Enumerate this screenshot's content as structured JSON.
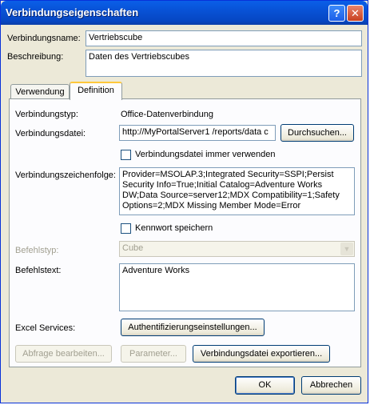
{
  "window": {
    "title": "Verbindungseigenschaften",
    "help_glyph": "?",
    "close_glyph": "✕"
  },
  "general": {
    "name_label": "Verbindungsname:",
    "name_value": "Vertriebscube",
    "desc_label": "Beschreibung:",
    "desc_value": "Daten des Vertriebscubes"
  },
  "tabs": [
    {
      "label": "Verwendung",
      "active": false
    },
    {
      "label": "Definition",
      "active": true
    }
  ],
  "definition": {
    "conn_type_label": "Verbindungstyp:",
    "conn_type_value": "Office-Datenverbindung",
    "conn_file_label": "Verbindungsdatei:",
    "conn_file_value": "http://MyPortalServer1 /reports/data c",
    "browse_label": "Durchsuchen...",
    "always_use_label": "Verbindungsdatei immer verwenden",
    "always_use_checked": false,
    "conn_string_label": "Verbindungszeichenfolge:",
    "conn_string_value": "Provider=MSOLAP.3;Integrated Security=SSPI;Persist Security Info=True;Initial Catalog=Adventure Works DW;Data Source=server12;MDX Compatibility=1;Safety Options=2;MDX Missing Member Mode=Error",
    "save_password_label": "Kennwort speichern",
    "save_password_checked": false,
    "cmd_type_label": "Befehlstyp:",
    "cmd_type_value": "Cube",
    "cmd_text_label": "Befehlstext:",
    "cmd_text_value": "Adventure Works",
    "excel_services_label": "Excel Services:",
    "auth_button": "Authentifizierungseinstellungen...",
    "edit_query_button": "Abfrage bearbeiten...",
    "parameters_button": "Parameter...",
    "export_button": "Verbindungsdatei exportieren..."
  },
  "footer": {
    "ok": "OK",
    "cancel": "Abbrechen"
  }
}
